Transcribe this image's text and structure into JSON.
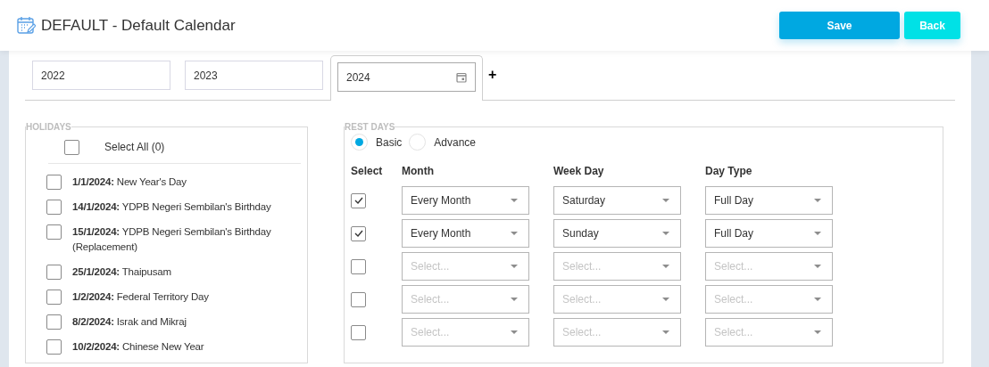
{
  "header": {
    "title": "DEFAULT - Default Calendar",
    "buttons": [
      {
        "label": "Save",
        "kind": "primary"
      },
      {
        "label": "Back",
        "kind": "secondary"
      }
    ]
  },
  "year_tabs": [
    {
      "label": "2022",
      "selected": false
    },
    {
      "label": "2023",
      "selected": false
    },
    {
      "label": "2024",
      "selected": true
    }
  ],
  "add_tab": "+",
  "holidays": {
    "legend": "HOLIDAYS",
    "select_all": {
      "label": "Select All (0)",
      "checked": false
    },
    "items": [
      {
        "date": "1/1/2024:",
        "name": "New Year's Day",
        "checked": false
      },
      {
        "date": "14/1/2024:",
        "name": "YDPB Negeri Sembilan's Birthday",
        "checked": false
      },
      {
        "date": "15/1/2024:",
        "name": "YDPB Negeri Sembilan's Birthday (Replacement)",
        "checked": false
      },
      {
        "date": "25/1/2024:",
        "name": "Thaipusam",
        "checked": false
      },
      {
        "date": "1/2/2024:",
        "name": "Federal Territory Day",
        "checked": false
      },
      {
        "date": "8/2/2024:",
        "name": "Israk and Mikraj",
        "checked": false
      },
      {
        "date": "10/2/2024:",
        "name": "Chinese New Year",
        "checked": false
      }
    ]
  },
  "rest_days": {
    "legend": "REST DAYS",
    "modes": [
      {
        "label": "Basic",
        "selected": true
      },
      {
        "label": "Advance",
        "selected": false
      }
    ],
    "columns": [
      "Select",
      "Month",
      "Week Day",
      "Day Type"
    ],
    "rows": [
      {
        "checked": true,
        "month": {
          "value": "Every Month"
        },
        "week_day": {
          "value": "Saturday"
        },
        "day_type": {
          "value": "Full Day"
        }
      },
      {
        "checked": true,
        "month": {
          "value": "Every Month"
        },
        "week_day": {
          "value": "Sunday"
        },
        "day_type": {
          "value": "Full Day"
        }
      },
      {
        "checked": false,
        "month": {
          "placeholder": "Select..."
        },
        "week_day": {
          "placeholder": "Select..."
        },
        "day_type": {
          "placeholder": "Select..."
        }
      },
      {
        "checked": false,
        "month": {
          "placeholder": "Select..."
        },
        "week_day": {
          "placeholder": "Select..."
        },
        "day_type": {
          "placeholder": "Select..."
        }
      },
      {
        "checked": false,
        "month": {
          "placeholder": "Select..."
        },
        "week_day": {
          "placeholder": "Select..."
        },
        "day_type": {
          "placeholder": "Select..."
        }
      }
    ]
  }
}
